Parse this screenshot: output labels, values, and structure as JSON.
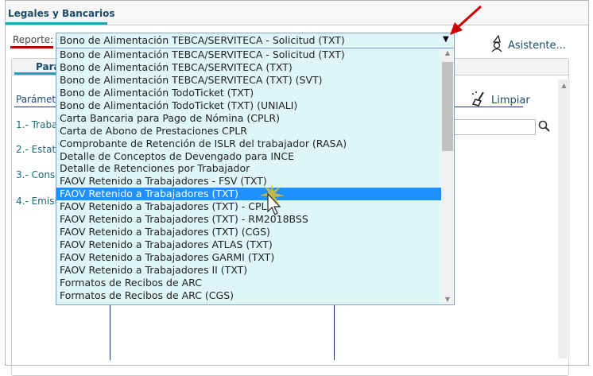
{
  "header": {
    "tab_label": "Legales y Bancarios"
  },
  "report": {
    "label": "Reporte:",
    "selected": "Bono de Alimentación TEBCA/SERVITECA - Solicitud (TXT)",
    "highlighted_index": 11,
    "options": [
      "Bono de Alimentación TEBCA/SERVITECA - Solicitud (TXT)",
      "Bono de Alimentación TEBCA/SERVITECA (TXT)",
      "Bono de Alimentación TEBCA/SERVITECA (TXT) (SVT)",
      "Bono de Alimentación TodoTicket (TXT)",
      "Bono de Alimentación TodoTicket (TXT) (UNIALI)",
      "Carta Bancaria para Pago de Nómina (CPLR)",
      "Carta de Abono de Prestaciones CPLR",
      "Comprobante de Retención de ISLR del trabajador (RASA)",
      "Detalle de Conceptos de Devengado para INCE",
      "Detalle de Retenciones por Trabajador",
      "FAOV Retenido a Trabajadores - FSV (TXT)",
      "FAOV Retenido a Trabajadores (TXT)",
      "FAOV Retenido a Trabajadores (TXT) - CPL",
      "FAOV Retenido a Trabajadores (TXT) - RM2018BSS",
      "FAOV Retenido a Trabajadores (TXT) (CGS)",
      "FAOV Retenido a Trabajadores ATLAS (TXT)",
      "FAOV Retenido a Trabajadores GARMI (TXT)",
      "FAOV Retenido a Trabajadores II (TXT)",
      "Formatos de Recibos de ARC",
      "Formatos de Recibos de ARC (CGS)"
    ]
  },
  "toolbar": {
    "assistant": "Asistente...",
    "clear": "Limpiar"
  },
  "panel": {
    "tab": "Pará",
    "params_label": "Parámetr",
    "steps": [
      "1.- Traba",
      "2.- Estat",
      "3.- Conse",
      "4.- Emisi"
    ]
  },
  "colors": {
    "accent": "#1fa3b8",
    "highlight": "#1e90ff",
    "list_bg": "#dff6f8",
    "annotation": "#bb0000"
  }
}
